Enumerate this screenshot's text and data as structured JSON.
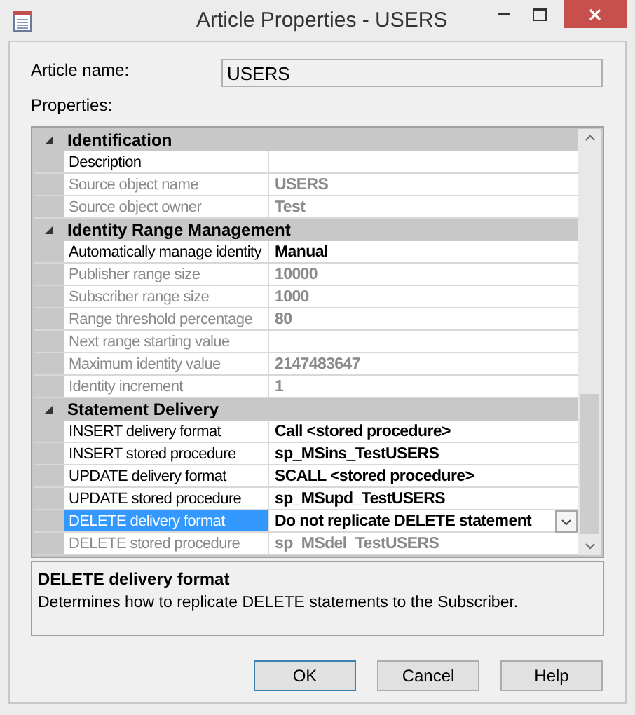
{
  "window": {
    "title": "Article Properties - USERS"
  },
  "article_name": {
    "label": "Article name:",
    "value": "USERS"
  },
  "properties_label": "Properties:",
  "sections": [
    {
      "title": "Identification",
      "expanded": true,
      "rows": [
        {
          "name": "Description",
          "disabled": false,
          "selected": false
        },
        {
          "name": "Source object name",
          "value": "USERS",
          "disabled": true,
          "selected": false
        },
        {
          "name": "Source object owner",
          "value": "Test",
          "disabled": true,
          "selected": false
        }
      ]
    },
    {
      "title": "Identity Range Management",
      "expanded": true,
      "rows": [
        {
          "name": "Automatically manage identity",
          "value": "Manual",
          "disabled": false,
          "selected": false
        },
        {
          "name": "Publisher range size",
          "value": "10000",
          "disabled": true,
          "selected": false
        },
        {
          "name": "Subscriber range size",
          "value": "1000",
          "disabled": true,
          "selected": false
        },
        {
          "name": "Range threshold percentage",
          "value": "80",
          "disabled": true,
          "selected": false
        },
        {
          "name": "Next range starting value",
          "disabled": true,
          "selected": false
        },
        {
          "name": "Maximum identity value",
          "value": "2147483647",
          "disabled": true,
          "selected": false
        },
        {
          "name": "Identity increment",
          "value": "1",
          "disabled": true,
          "selected": false
        }
      ]
    },
    {
      "title": "Statement Delivery",
      "expanded": true,
      "rows": [
        {
          "name": "INSERT delivery format",
          "value": "Call <stored procedure>",
          "disabled": false,
          "selected": false
        },
        {
          "name": "INSERT stored procedure",
          "value": "sp_MSins_TestUSERS",
          "disabled": false,
          "selected": false
        },
        {
          "name": "UPDATE delivery format",
          "value": "SCALL <stored procedure>",
          "disabled": false,
          "selected": false
        },
        {
          "name": "UPDATE stored procedure",
          "value": "sp_MSupd_TestUSERS",
          "disabled": false,
          "selected": false
        },
        {
          "name": "DELETE delivery format",
          "value": "Do not replicate DELETE statement",
          "disabled": false,
          "selected": true
        },
        {
          "name": "DELETE stored procedure",
          "value": "sp_MSdel_TestUSERS",
          "disabled": true,
          "selected": false
        }
      ]
    }
  ],
  "description": {
    "title": "DELETE delivery format",
    "text": "Determines how to replicate DELETE statements to the Subscriber."
  },
  "buttons": [
    {
      "label": "OK",
      "default": true
    },
    {
      "label": "Cancel",
      "default": false
    },
    {
      "label": "Help",
      "default": false
    }
  ]
}
